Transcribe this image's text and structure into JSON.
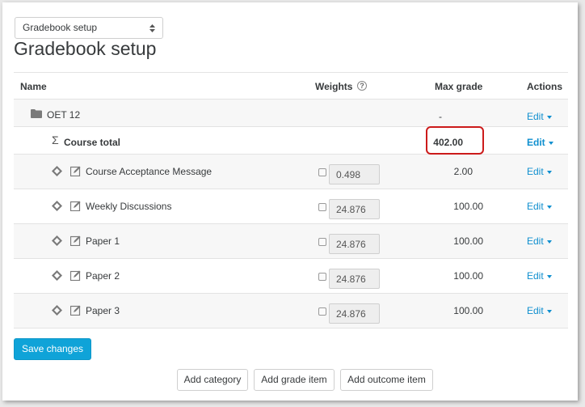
{
  "page_selector": {
    "value": "Gradebook setup"
  },
  "page_title": "Gradebook setup",
  "table": {
    "headers": {
      "name": "Name",
      "weights": "Weights",
      "max_grade": "Max grade",
      "actions": "Actions"
    },
    "category": {
      "name": "OET 12",
      "max_grade": "-",
      "action": "Edit"
    },
    "course_total": {
      "name": "Course total",
      "max_grade": "402.00",
      "action": "Edit"
    },
    "items": [
      {
        "name": "Course Acceptance Message",
        "weight": "0.498",
        "max_grade": "2.00",
        "action": "Edit"
      },
      {
        "name": "Weekly Discussions",
        "weight": "24.876",
        "max_grade": "100.00",
        "action": "Edit"
      },
      {
        "name": "Paper 1",
        "weight": "24.876",
        "max_grade": "100.00",
        "action": "Edit"
      },
      {
        "name": "Paper 2",
        "weight": "24.876",
        "max_grade": "100.00",
        "action": "Edit"
      },
      {
        "name": "Paper 3",
        "weight": "24.876",
        "max_grade": "100.00",
        "action": "Edit"
      }
    ]
  },
  "buttons": {
    "save": "Save changes",
    "add_category": "Add category",
    "add_grade_item": "Add grade item",
    "add_outcome_item": "Add outcome item"
  },
  "colors": {
    "link": "#0f8fcf",
    "primary": "#0fa3d8",
    "highlight": "#cc1b1b"
  }
}
